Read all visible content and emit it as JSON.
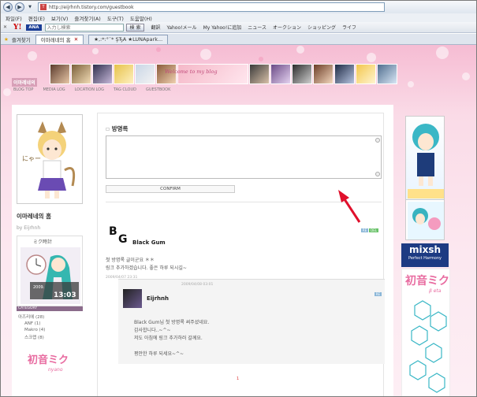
{
  "browser": {
    "url": "http://eijrhnh.tistory.com/guestbook",
    "menu": [
      "파일(F)",
      "편집(E)",
      "보기(V)",
      "즐겨찾기(A)",
      "도구(T)",
      "도움말(H)"
    ],
    "toolbar": {
      "yahoo": "Y!",
      "ana": "ANA",
      "search_placeholder": "入力し検索",
      "search_button": "検 索",
      "items": [
        "翻訳",
        "Yahoo!メール",
        "My Yahoo!に追加",
        "ニュース",
        "オークション",
        "ショッピング",
        "ライフ"
      ]
    },
    "favorites_label": "즐겨찾기",
    "tabs": [
      {
        "label": "이마레네의 홈"
      },
      {
        "label": "★,:*:°¨* ŞЂA ★LUNApark..."
      }
    ]
  },
  "blog": {
    "name": "이마레네의",
    "banner_text": "Welcome to my blog",
    "nav": [
      "BLOG TOP",
      "MEDIA LOG",
      "LOCATION LOG",
      "TAG CLOUD",
      "GUESTBOOK"
    ],
    "title": "이마레네의 홈",
    "owner": "by Eijrhnh",
    "clock_title": "ミク時計",
    "clock_date": "2009.",
    "clock_time": "13:03",
    "category_label": "CATEGORY",
    "categories": [
      {
        "label": "아즈리에 (28)"
      },
      {
        "label": "ANF (1)"
      },
      {
        "label": "Makro (4)"
      },
      {
        "label": "스크랩 (8)"
      }
    ],
    "miku_badge_title": "初音ミク",
    "miku_badge_sub": "nyano"
  },
  "guestbook": {
    "title": "방명록",
    "confirm_label": "CONFIRM",
    "entry": {
      "author": "Black Gum",
      "text": "첫 방명록 글이군요 ＊＊\n링크 추가하겠습니다. 좋은 하루 되시길~",
      "date": "2009/04/07 23:31"
    },
    "reply": {
      "author": "Eijrhnh",
      "date": "2009/04/08 03:01",
      "text": "Black Gum님 첫 방명록 써주셨네요.\n감사합니다..~^~\n저도 아침에 링크 추가하러 갈께요.\n\n평안한 하루 되세요~^~"
    },
    "pager": "1"
  },
  "sidebar_ads": {
    "mixsh_big": "mixsh",
    "mixsh_small": "Perfect Harmony",
    "miku_beta_title": "初音ミク",
    "miku_beta_sub": "β eta"
  },
  "colors": {
    "page_pink": "#f6bcd3",
    "mixsh_blue": "#1d3b83",
    "arrow_red": "#e0102c"
  }
}
